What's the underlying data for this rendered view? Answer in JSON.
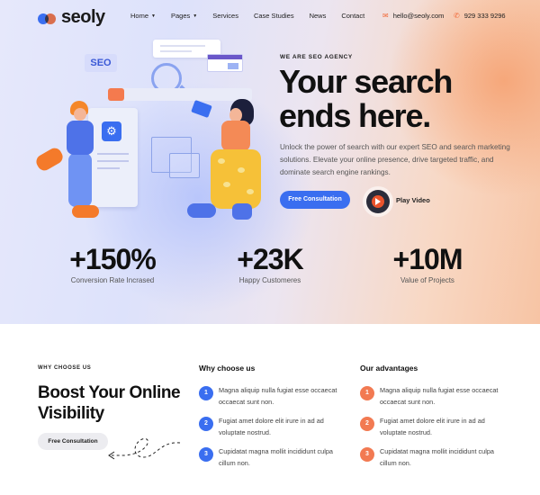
{
  "brand": {
    "name": "seoly"
  },
  "nav": {
    "items": [
      {
        "label": "Home",
        "dropdown": true
      },
      {
        "label": "Pages",
        "dropdown": true
      },
      {
        "label": "Services",
        "dropdown": false
      },
      {
        "label": "Case Studies",
        "dropdown": false
      },
      {
        "label": "News",
        "dropdown": false
      },
      {
        "label": "Contact",
        "dropdown": false
      }
    ],
    "email": "hello@seoly.com",
    "phone": "929 333 9296"
  },
  "illustration": {
    "badge": "SEO"
  },
  "hero": {
    "eyebrow": "WE ARE SEO AGENCY",
    "title": "Your search ends here.",
    "lead": "Unlock the power of search with our expert SEO and search marketing solutions. Elevate your online presence, drive targeted traffic, and dominate search engine rankings.",
    "primary_button": "Free Consultation",
    "play_label": "Play Video"
  },
  "stats": [
    {
      "value": "+150%",
      "label": "Conversion Rate Incrased"
    },
    {
      "value": "+23K",
      "label": "Happy Customeres"
    },
    {
      "value": "+10M",
      "label": "Value of Projects"
    }
  ],
  "why": {
    "eyebrow": "WHY CHOOSE US",
    "title": "Boost Your Online Visibility",
    "button": "Free Consultation",
    "col1": {
      "heading": "Why choose us",
      "items": [
        {
          "n": "1",
          "text": "Magna aliquip nulla fugiat esse occaecat occaecat sunt non."
        },
        {
          "n": "2",
          "text": "Fugiat amet dolore elit irure in ad ad voluptate nostrud."
        },
        {
          "n": "3",
          "text": "Cupidatat magna mollit incididunt culpa cillum non."
        }
      ]
    },
    "col2": {
      "heading": "Our advantages",
      "items": [
        {
          "n": "1",
          "text": "Magna aliquip nulla fugiat esse occaecat occaecat sunt non."
        },
        {
          "n": "2",
          "text": "Fugiat amet dolore elit irure in ad ad voluptate nostrud."
        },
        {
          "n": "3",
          "text": "Cupidatat magna mollit incididunt culpa cillum non."
        }
      ]
    }
  },
  "colors": {
    "accent_blue": "#3a6ef0",
    "accent_orange": "#f27a52"
  }
}
